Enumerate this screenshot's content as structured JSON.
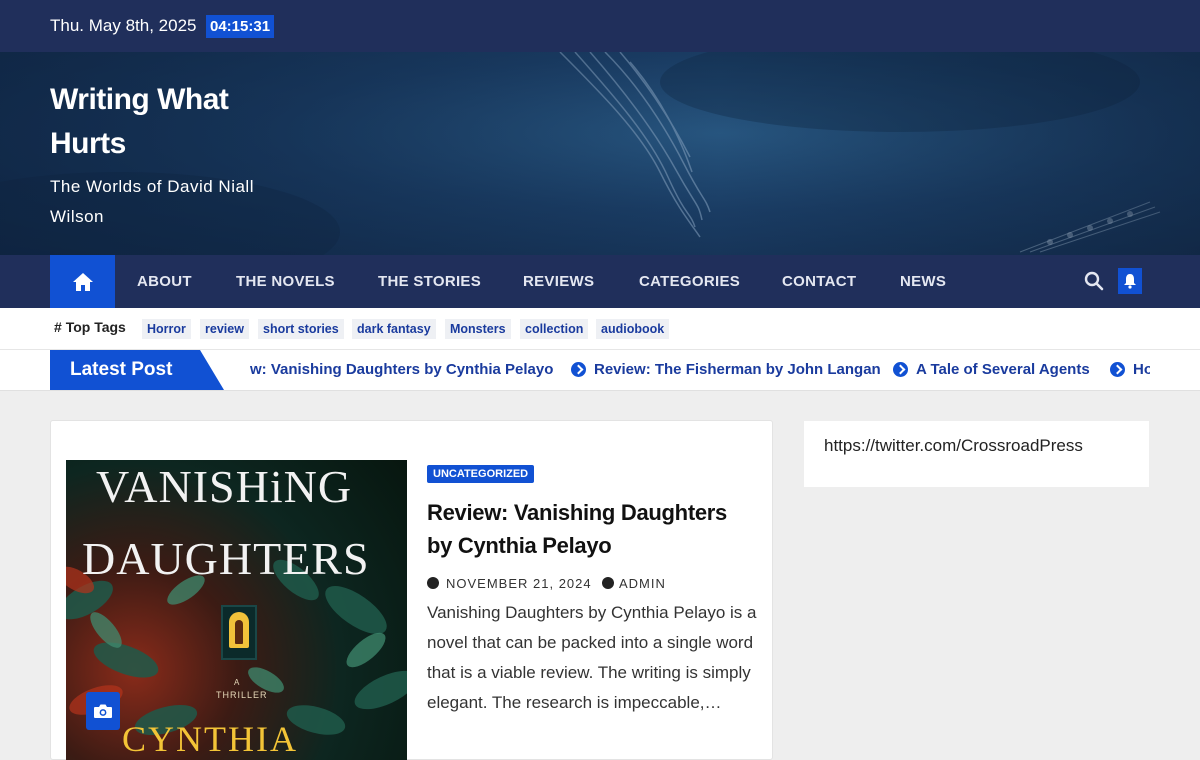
{
  "topbar": {
    "date": "Thu. May 8th, 2025",
    "time": "04:15:31"
  },
  "site": {
    "title": "Writing What Hurts",
    "tagline": "The Worlds of David Niall Wilson"
  },
  "nav": {
    "items": [
      "ABOUT",
      "THE NOVELS",
      "THE STORIES",
      "REVIEWS",
      "CATEGORIES",
      "CONTACT",
      "NEWS"
    ],
    "icons": [
      "home-icon",
      "search-icon",
      "bell-icon"
    ]
  },
  "tags": {
    "label": "Top Tags",
    "items": [
      "Horror",
      "review",
      "short stories",
      "dark fantasy",
      "Monsters",
      "collection",
      "audiobook"
    ]
  },
  "ticker": {
    "label": "Latest Post",
    "items": [
      "w: Vanishing Daughters by Cynthia Pelayo",
      "Review: The Fisherman by John Langan",
      "A Tale of Several Agents",
      "Ho"
    ]
  },
  "post": {
    "category": "UNCATEGORIZED",
    "title": "Review: Vanishing Daughters by Cynthia Pelayo",
    "date": "NOVEMBER 21, 2024",
    "author": "ADMIN",
    "excerpt": "Vanishing Daughters by Cynthia Pelayo is a novel that can be packed into a single word that is a viable review. The writing is simply elegant. The research is impeccable,…",
    "cover": {
      "title_line1": "VANISHiNG",
      "title_line2": "DAUGHTERS",
      "subtitle_a": "A",
      "subtitle_b": "THRILLER",
      "author": "CYNTHIA"
    }
  },
  "sidebar": {
    "widget_text": "https://twitter.com/CrossroadPress"
  },
  "colors": {
    "navy": "#202f5b",
    "accent": "#1151d3",
    "link": "#1a3b9e"
  }
}
